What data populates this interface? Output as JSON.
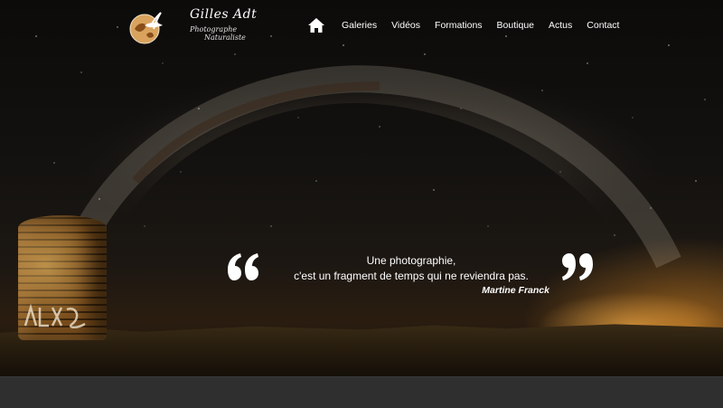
{
  "brand": {
    "name": "Gilles Adt",
    "subtitle_line1": "Photographe",
    "subtitle_line2": "Naturaliste",
    "logo_icon": "bird-globe-logo-icon"
  },
  "nav": {
    "home_icon": "home-icon",
    "items": [
      {
        "label": "Galeries"
      },
      {
        "label": "Vidéos"
      },
      {
        "label": "Formations"
      },
      {
        "label": "Boutique"
      },
      {
        "label": "Actus"
      },
      {
        "label": "Contact"
      }
    ]
  },
  "hero": {
    "quote_line1": "Une photographie,",
    "quote_line2": "c'est un fragment de temps qui ne reviendra pas.",
    "author": "Martine Franck",
    "open_quote_icon": "open-quote-icon",
    "close_quote_icon": "close-quote-icon"
  },
  "colors": {
    "text": "#ffffff",
    "glow": "#f0962a",
    "footer": "#2f2f2f"
  }
}
